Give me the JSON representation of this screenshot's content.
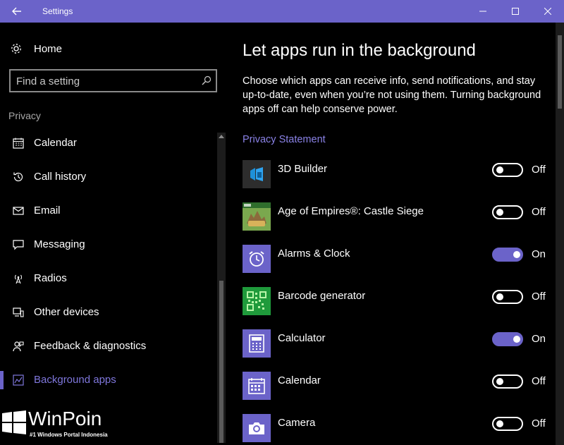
{
  "window": {
    "title": "Settings"
  },
  "sidebar": {
    "home_label": "Home",
    "search_placeholder": "Find a setting",
    "section_title": "Privacy",
    "items": [
      {
        "label": "Calendar",
        "icon": "calendar-icon"
      },
      {
        "label": "Call history",
        "icon": "history-icon"
      },
      {
        "label": "Email",
        "icon": "email-icon"
      },
      {
        "label": "Messaging",
        "icon": "message-icon"
      },
      {
        "label": "Radios",
        "icon": "radio-tower-icon"
      },
      {
        "label": "Other devices",
        "icon": "devices-icon"
      },
      {
        "label": "Feedback & diagnostics",
        "icon": "feedback-icon"
      },
      {
        "label": "Background apps",
        "icon": "background-apps-icon",
        "active": true
      }
    ]
  },
  "main": {
    "title": "Let apps run in the background",
    "description": "Choose which apps can receive info, send notifications, and stay up-to-date, even when you’re not using them. Turning background apps off can help conserve power.",
    "privacy_link": "Privacy Statement",
    "apps": [
      {
        "name": "3D Builder",
        "state": "Off",
        "on": false
      },
      {
        "name": "Age of Empires®: Castle Siege",
        "state": "Off",
        "on": false
      },
      {
        "name": "Alarms & Clock",
        "state": "On",
        "on": true
      },
      {
        "name": "Barcode generator",
        "state": "Off",
        "on": false
      },
      {
        "name": "Calculator",
        "state": "On",
        "on": true
      },
      {
        "name": "Calendar",
        "state": "Off",
        "on": false
      },
      {
        "name": "Camera",
        "state": "Off",
        "on": false
      }
    ]
  },
  "watermark": {
    "brand": "WinPoin",
    "tagline": "#1 Windows Portal Indonesia"
  },
  "colors": {
    "accent": "#6b63c9",
    "link": "#8a82e6",
    "background": "#000000"
  }
}
